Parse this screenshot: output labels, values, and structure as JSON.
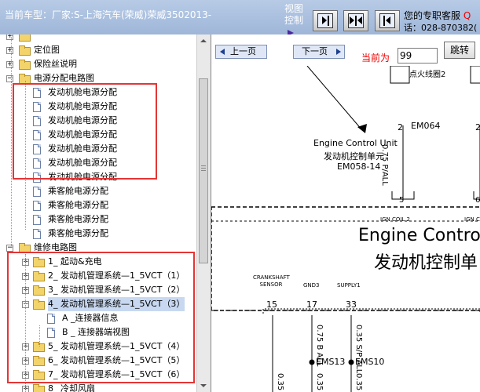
{
  "header": {
    "car_label": "当前车型：厂家:S-上海汽车(荣威)荣威3502013-",
    "view_label": "视图控制",
    "contact_line1": "您的专职客服",
    "contact_qq": "Q",
    "contact_line2": "话：028-870382("
  },
  "tree": {
    "items": [
      {
        "label": "",
        "icon": "folder-icon",
        "expander": "+",
        "indent": 0
      },
      {
        "label": "定位图",
        "icon": "folder-icon",
        "expander": "+",
        "indent": 0
      },
      {
        "label": "保险丝说明",
        "icon": "folder-icon",
        "expander": "+",
        "indent": 0
      },
      {
        "label": "电源分配电路图",
        "icon": "folder-icon",
        "expander": "-",
        "indent": 0
      },
      {
        "label": "发动机舱电源分配",
        "icon": "document-icon",
        "expander": "",
        "indent": 1
      },
      {
        "label": "发动机舱电源分配",
        "icon": "document-icon",
        "expander": "",
        "indent": 1
      },
      {
        "label": "发动机舱电源分配",
        "icon": "document-icon",
        "expander": "",
        "indent": 1
      },
      {
        "label": "发动机舱电源分配",
        "icon": "document-icon",
        "expander": "",
        "indent": 1
      },
      {
        "label": "发动机舱电源分配",
        "icon": "document-icon",
        "expander": "",
        "indent": 1
      },
      {
        "label": "发动机舱电源分配",
        "icon": "document-icon",
        "expander": "",
        "indent": 1
      },
      {
        "label": "发动机舱电源分配",
        "icon": "document-icon",
        "expander": "",
        "indent": 1
      },
      {
        "label": "乘客舱电源分配",
        "icon": "document-icon",
        "expander": "",
        "indent": 1
      },
      {
        "label": "乘客舱电源分配",
        "icon": "document-icon",
        "expander": "",
        "indent": 1
      },
      {
        "label": "乘客舱电源分配",
        "icon": "document-icon",
        "expander": "",
        "indent": 1
      },
      {
        "label": "乘客舱电源分配",
        "icon": "document-icon",
        "expander": "",
        "indent": 1
      },
      {
        "label": "维修电路图",
        "icon": "folder-icon",
        "expander": "-",
        "indent": 0
      },
      {
        "label": "1_ 起动&充电",
        "icon": "folder-icon",
        "expander": "+",
        "indent": 1
      },
      {
        "label": "2_ 发动机管理系统—1_5VCT（1）",
        "icon": "folder-icon",
        "expander": "+",
        "indent": 1
      },
      {
        "label": "3_ 发动机管理系统—1_5VCT（2）",
        "icon": "folder-icon",
        "expander": "+",
        "indent": 1
      },
      {
        "label": "4_ 发动机管理系统—1_5VCT（3）",
        "icon": "folder-icon",
        "expander": "-",
        "indent": 1,
        "selected": true
      },
      {
        "label": "A _连接器信息",
        "icon": "document-icon",
        "expander": "",
        "indent": 2
      },
      {
        "label": "B _ 连接器端视图",
        "icon": "document-icon",
        "expander": "",
        "indent": 2
      },
      {
        "label": "5_ 发动机管理系统—1_5VCT（4）",
        "icon": "folder-icon",
        "expander": "+",
        "indent": 1
      },
      {
        "label": "6_ 发动机管理系统—1_5VCT（5）",
        "icon": "folder-icon",
        "expander": "+",
        "indent": 1
      },
      {
        "label": "7_ 发动机管理系统—1_5VCT（6）",
        "icon": "folder-icon",
        "expander": "+",
        "indent": 1
      },
      {
        "label": "8_ 冷却风扇",
        "icon": "folder-icon",
        "expander": "+",
        "indent": 1
      }
    ]
  },
  "nav": {
    "prev_label": "上一页",
    "next_label": "下一页",
    "page_label": "当前为",
    "page_value": "99",
    "go_label": "跳转"
  },
  "diagram": {
    "ref_label": "点火线圈2",
    "ecu_en": "Engine Control Unit",
    "ecu_cn": "发动机控制单元",
    "ecu_code": "EM058-14",
    "pin_top_left": "2",
    "pin_top_right": "2",
    "connector_top": "EM064",
    "wire_top": "0.75 P/ALL",
    "pin_mid": "5",
    "pin_mid_right": "6",
    "ign_coil_left": "IGN COIL 2",
    "ign_coil_right": "IGN C",
    "box_title_en": "Engine Contro",
    "box_title_cn": "发动机控制单",
    "sig_crank": "CRANKSHAFT SENSOR",
    "sig_gnd": "GND3",
    "sig_supply": "SUPPLY1",
    "pin_15": "15",
    "pin_17": "17",
    "pin_33": "33",
    "wire_b": "0.75 B ALL",
    "wire_s": "0.35 S/P ALL",
    "splice_1": "EMS13",
    "splice_2": "EMS10",
    "wire_bottom_1": "0.35",
    "wire_bottom_2": "0.35",
    "wire_bottom_3": "0.35"
  },
  "colors": {
    "highlight_box": "#e43535",
    "page_label": "#e00000",
    "header_bg": "#a9bfe0"
  }
}
